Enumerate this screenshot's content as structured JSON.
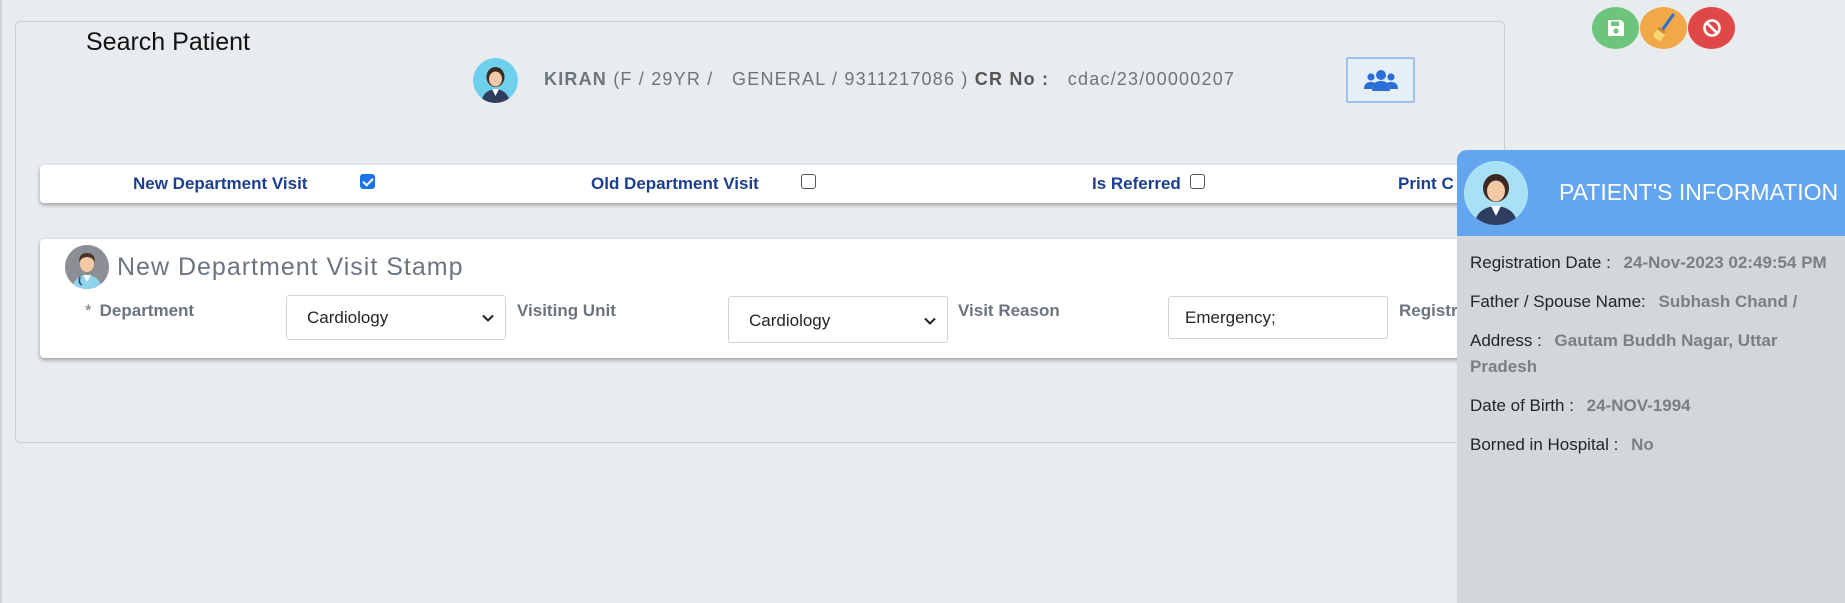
{
  "page_title": "Search Patient",
  "patient": {
    "name": "KIRAN",
    "gender_age": "(F  /  29YR  /",
    "category": "GENERAL  /  9311217086  )",
    "cr_label": "CR No :",
    "cr_no": "cdac/23/00000207"
  },
  "actions": {
    "save": "floppy-disk-icon",
    "clear": "broom-icon",
    "cancel": "ban-icon",
    "family": "users-icon"
  },
  "visit_type": {
    "new_label": "New  Department  Visit",
    "new_checked": true,
    "old_label": "Old Department Visit",
    "old_checked": false,
    "referred_label": "Is Referred",
    "referred_checked": false,
    "print_label": "Print C"
  },
  "stamp": {
    "title": "New Department Visit Stamp",
    "required_mark": "*",
    "department_label": "Department",
    "department_value": "Cardiology",
    "unit_label": "Visiting Unit",
    "unit_value": "Cardiology",
    "reason_label": "Visit Reason",
    "reason_value": "Emergency;",
    "registration_label": "Registr"
  },
  "patient_info": {
    "title": "PATIENT'S INFORMATION",
    "registration_date_label": "Registration Date :",
    "registration_date": "24-Nov-2023 02:49:54 PM",
    "father_label": "Father / Spouse Name:",
    "father_value": "Subhash Chand /",
    "address_label": "Address :",
    "address_value": "Gautam Buddh Nagar, Uttar Pradesh",
    "dob_label": "Date of Birth :",
    "dob_value": "24-NOV-1994",
    "born_label": "Borned in Hospital :",
    "born_value": "No"
  },
  "colors": {
    "accent_blue": "#64a5ef",
    "label_navy": "#1d3f8f",
    "save_green": "#6dc57b",
    "clear_orange": "#f0a848",
    "cancel_red": "#e04848"
  }
}
